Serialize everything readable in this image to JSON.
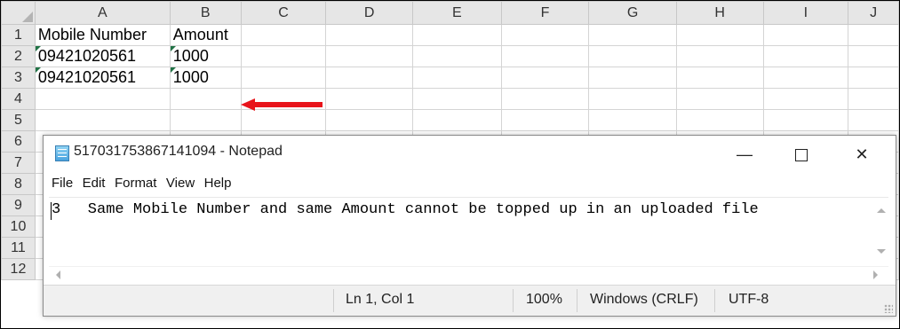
{
  "spreadsheet": {
    "column_headers": [
      "A",
      "B",
      "C",
      "D",
      "E",
      "F",
      "G",
      "H",
      "I",
      "J"
    ],
    "row_headers": [
      "1",
      "2",
      "3",
      "4",
      "5",
      "6",
      "7",
      "8",
      "9",
      "10",
      "11",
      "12"
    ],
    "cells": {
      "a1": "Mobile Number",
      "b1": "Amount",
      "a2": "09421020561",
      "b2": "1000",
      "a3": "09421020561",
      "b3": "1000"
    },
    "arrow_color": "#e8141b"
  },
  "notepad": {
    "title": "517031753867141094 - Notepad",
    "window_controls": {
      "minimize": "—",
      "close": "✕"
    },
    "menu": [
      "File",
      "Edit",
      "Format",
      "View",
      "Help"
    ],
    "content": "3   Same Mobile Number and same Amount cannot be topped up in an uploaded file",
    "status": {
      "position": "Ln 1, Col 1",
      "zoom": "100%",
      "line_ending": "Windows (CRLF)",
      "encoding": "UTF-8"
    }
  }
}
